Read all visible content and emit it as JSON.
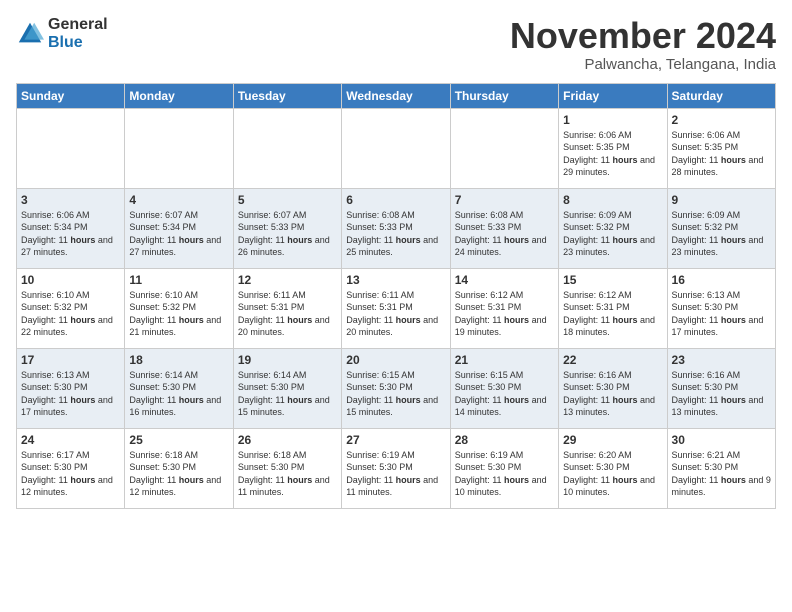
{
  "logo": {
    "general": "General",
    "blue": "Blue"
  },
  "title": "November 2024",
  "subtitle": "Palwancha, Telangana, India",
  "weekdays": [
    "Sunday",
    "Monday",
    "Tuesday",
    "Wednesday",
    "Thursday",
    "Friday",
    "Saturday"
  ],
  "weeks": [
    [
      {
        "day": "",
        "info": ""
      },
      {
        "day": "",
        "info": ""
      },
      {
        "day": "",
        "info": ""
      },
      {
        "day": "",
        "info": ""
      },
      {
        "day": "",
        "info": ""
      },
      {
        "day": "1",
        "info": "Sunrise: 6:06 AM\nSunset: 5:35 PM\nDaylight: 11 hours and 29 minutes."
      },
      {
        "day": "2",
        "info": "Sunrise: 6:06 AM\nSunset: 5:35 PM\nDaylight: 11 hours and 28 minutes."
      }
    ],
    [
      {
        "day": "3",
        "info": "Sunrise: 6:06 AM\nSunset: 5:34 PM\nDaylight: 11 hours and 27 minutes."
      },
      {
        "day": "4",
        "info": "Sunrise: 6:07 AM\nSunset: 5:34 PM\nDaylight: 11 hours and 27 minutes."
      },
      {
        "day": "5",
        "info": "Sunrise: 6:07 AM\nSunset: 5:33 PM\nDaylight: 11 hours and 26 minutes."
      },
      {
        "day": "6",
        "info": "Sunrise: 6:08 AM\nSunset: 5:33 PM\nDaylight: 11 hours and 25 minutes."
      },
      {
        "day": "7",
        "info": "Sunrise: 6:08 AM\nSunset: 5:33 PM\nDaylight: 11 hours and 24 minutes."
      },
      {
        "day": "8",
        "info": "Sunrise: 6:09 AM\nSunset: 5:32 PM\nDaylight: 11 hours and 23 minutes."
      },
      {
        "day": "9",
        "info": "Sunrise: 6:09 AM\nSunset: 5:32 PM\nDaylight: 11 hours and 23 minutes."
      }
    ],
    [
      {
        "day": "10",
        "info": "Sunrise: 6:10 AM\nSunset: 5:32 PM\nDaylight: 11 hours and 22 minutes."
      },
      {
        "day": "11",
        "info": "Sunrise: 6:10 AM\nSunset: 5:32 PM\nDaylight: 11 hours and 21 minutes."
      },
      {
        "day": "12",
        "info": "Sunrise: 6:11 AM\nSunset: 5:31 PM\nDaylight: 11 hours and 20 minutes."
      },
      {
        "day": "13",
        "info": "Sunrise: 6:11 AM\nSunset: 5:31 PM\nDaylight: 11 hours and 20 minutes."
      },
      {
        "day": "14",
        "info": "Sunrise: 6:12 AM\nSunset: 5:31 PM\nDaylight: 11 hours and 19 minutes."
      },
      {
        "day": "15",
        "info": "Sunrise: 6:12 AM\nSunset: 5:31 PM\nDaylight: 11 hours and 18 minutes."
      },
      {
        "day": "16",
        "info": "Sunrise: 6:13 AM\nSunset: 5:30 PM\nDaylight: 11 hours and 17 minutes."
      }
    ],
    [
      {
        "day": "17",
        "info": "Sunrise: 6:13 AM\nSunset: 5:30 PM\nDaylight: 11 hours and 17 minutes."
      },
      {
        "day": "18",
        "info": "Sunrise: 6:14 AM\nSunset: 5:30 PM\nDaylight: 11 hours and 16 minutes."
      },
      {
        "day": "19",
        "info": "Sunrise: 6:14 AM\nSunset: 5:30 PM\nDaylight: 11 hours and 15 minutes."
      },
      {
        "day": "20",
        "info": "Sunrise: 6:15 AM\nSunset: 5:30 PM\nDaylight: 11 hours and 15 minutes."
      },
      {
        "day": "21",
        "info": "Sunrise: 6:15 AM\nSunset: 5:30 PM\nDaylight: 11 hours and 14 minutes."
      },
      {
        "day": "22",
        "info": "Sunrise: 6:16 AM\nSunset: 5:30 PM\nDaylight: 11 hours and 13 minutes."
      },
      {
        "day": "23",
        "info": "Sunrise: 6:16 AM\nSunset: 5:30 PM\nDaylight: 11 hours and 13 minutes."
      }
    ],
    [
      {
        "day": "24",
        "info": "Sunrise: 6:17 AM\nSunset: 5:30 PM\nDaylight: 11 hours and 12 minutes."
      },
      {
        "day": "25",
        "info": "Sunrise: 6:18 AM\nSunset: 5:30 PM\nDaylight: 11 hours and 12 minutes."
      },
      {
        "day": "26",
        "info": "Sunrise: 6:18 AM\nSunset: 5:30 PM\nDaylight: 11 hours and 11 minutes."
      },
      {
        "day": "27",
        "info": "Sunrise: 6:19 AM\nSunset: 5:30 PM\nDaylight: 11 hours and 11 minutes."
      },
      {
        "day": "28",
        "info": "Sunrise: 6:19 AM\nSunset: 5:30 PM\nDaylight: 11 hours and 10 minutes."
      },
      {
        "day": "29",
        "info": "Sunrise: 6:20 AM\nSunset: 5:30 PM\nDaylight: 11 hours and 10 minutes."
      },
      {
        "day": "30",
        "info": "Sunrise: 6:21 AM\nSunset: 5:30 PM\nDaylight: 11 hours and 9 minutes."
      }
    ]
  ]
}
